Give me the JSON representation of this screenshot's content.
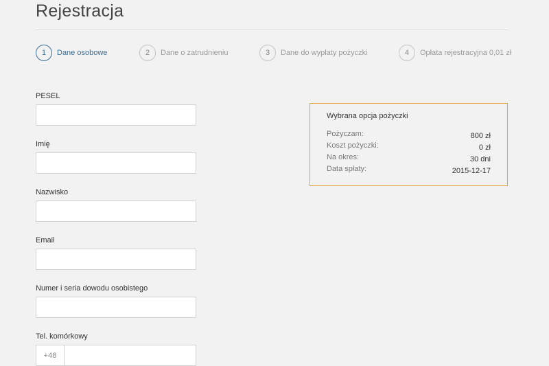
{
  "page": {
    "title": "Rejestracja"
  },
  "steps": [
    {
      "number": "1",
      "label": "Dane osobowe",
      "active": true
    },
    {
      "number": "2",
      "label": "Dane o zatrudnieniu",
      "active": false
    },
    {
      "number": "3",
      "label": "Dane do wypłaty pożyczki",
      "active": false
    },
    {
      "number": "4",
      "label": "Opłata rejestracyjna 0,01 zł",
      "active": false
    }
  ],
  "form": {
    "pesel_label": "PESEL",
    "pesel_value": "",
    "imie_label": "Imię",
    "imie_value": "",
    "nazwisko_label": "Nazwisko",
    "nazwisko_value": "",
    "email_label": "Email",
    "email_value": "",
    "dowod_label": "Numer i seria dowodu osobistego",
    "dowod_value": "",
    "tel_label": "Tel. komórkowy",
    "tel_prefix": "+48",
    "tel_value": ""
  },
  "summary": {
    "title": "Wybrana opcja pożyczki",
    "rows": [
      {
        "key": "Pożyczam:",
        "value": "800 zł"
      },
      {
        "key": "Koszt pożyczki:",
        "value": "0 zł"
      },
      {
        "key": "Na okres:",
        "value": "30 dni"
      },
      {
        "key": "Data spłaty:",
        "value": "2015-12-17"
      }
    ]
  },
  "colors": {
    "background": "#f2f2f2",
    "active_step": "#3a6e96",
    "summary_border": "#e8a33b",
    "input_border": "#d2d2d2"
  }
}
